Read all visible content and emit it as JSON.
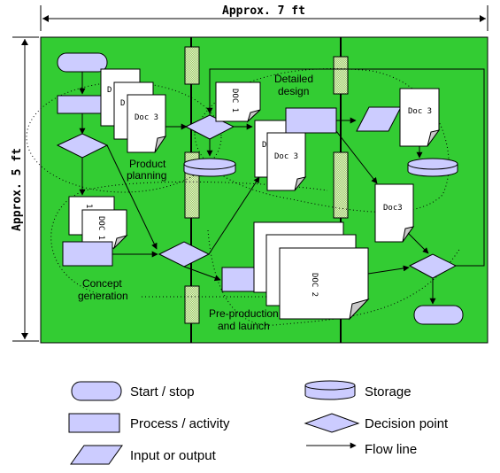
{
  "dimensions": {
    "width_label": "Approx. 7 ft",
    "height_label": "Approx. 5 ft"
  },
  "colors": {
    "board": "#33cc33",
    "shape_fill": "#ccccff",
    "document": "#ffffff",
    "fold": "#c8c8c8",
    "post": "#aadd88"
  },
  "phases": [
    {
      "id": "product-planning",
      "label_lines": [
        "Product",
        "planning"
      ]
    },
    {
      "id": "concept-generation",
      "label_lines": [
        "Concept",
        "generation"
      ]
    },
    {
      "id": "detailed-design",
      "label_lines": [
        "Detailed",
        "design"
      ]
    },
    {
      "id": "pre-production",
      "label_lines": [
        "Pre-production",
        "and launch"
      ]
    }
  ],
  "documents": {
    "doc1": "DOC 1",
    "doc1_partial": "1",
    "doc_d": "D",
    "doc2": "DOC 2",
    "doc3": "Doc 3",
    "doc3_alt": "Doc3"
  },
  "legend": [
    {
      "shape": "start-stop",
      "label": "Start / stop"
    },
    {
      "shape": "process",
      "label": "Process / activity"
    },
    {
      "shape": "input-output",
      "label": "Input or output"
    },
    {
      "shape": "storage",
      "label": "Storage"
    },
    {
      "shape": "decision",
      "label": "Decision point"
    },
    {
      "shape": "flow-line",
      "label": "Flow line"
    }
  ]
}
